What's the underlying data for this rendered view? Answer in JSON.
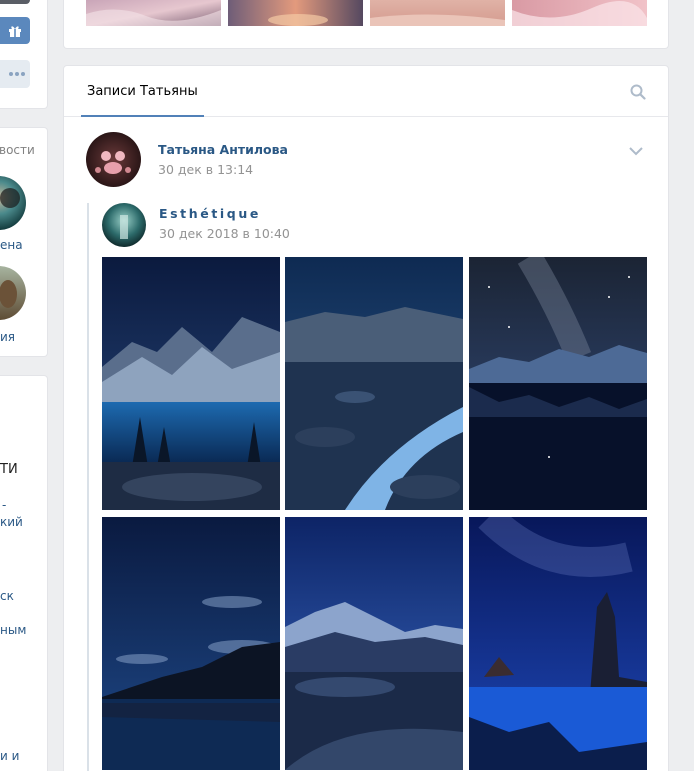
{
  "sidebar": {
    "friends_heading_fragment": "вости",
    "friend_1_name_fragment": "ена",
    "friend_2_name_fragment": "ия",
    "list_fragments": [
      "ТИ",
      "-",
      "кий",
      "ск",
      "ным",
      "и и"
    ]
  },
  "wall": {
    "tab_label": "Записи Татьяны",
    "post": {
      "author": "Татьяна Антилова",
      "date": "30 дек в 13:14",
      "repost": {
        "author": "Esthétique",
        "date": "30 дек 2018 в 10:40"
      }
    }
  },
  "icons": {
    "gift": "gift-icon",
    "more": "more-dots-icon",
    "search": "search-icon",
    "chevron": "chevron-down-icon"
  },
  "colors": {
    "link": "#2a5885",
    "accent": "#5181b8",
    "background": "#edeef0"
  }
}
